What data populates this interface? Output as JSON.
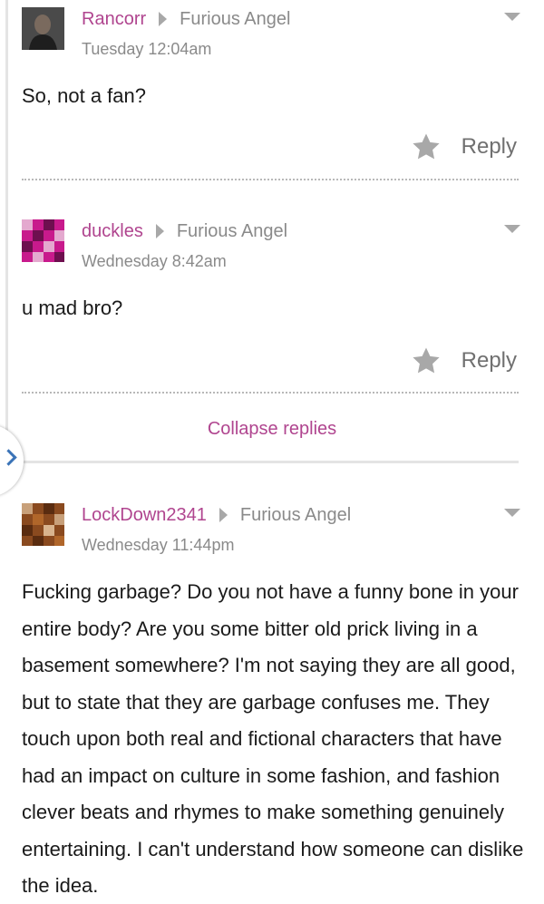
{
  "comments": [
    {
      "author": "Rancorr",
      "reply_to": "Furious Angel",
      "time": "Tuesday 12:04am",
      "body": "So, not a fan?",
      "reply_label": "Reply",
      "avatar_icon": "user-photo-avatar"
    },
    {
      "author": "duckles",
      "reply_to": "Furious Angel",
      "time": "Wednesday 8:42am",
      "body": "u mad bro?",
      "reply_label": "Reply",
      "avatar_icon": "pixel-avatar-magenta"
    },
    {
      "author": "LockDown2341",
      "reply_to": "Furious Angel",
      "time": "Wednesday 11:44pm",
      "body": "Fucking garbage? Do you not have a funny bone in your entire body? Are you some bitter old prick living in a basement somewhere? I'm not saying they are all good, but to state that they are garbage confuses me. They touch upon both real and fictional characters that have had an impact on culture in some fashion, and fashion clever beats and rhymes to make something genuinely entertaining. I can't understand how someone can dislike the idea.",
      "avatar_icon": "pixel-avatar-brown"
    }
  ],
  "collapse_label": "Collapse replies",
  "colors": {
    "author": "#b0458f",
    "meta": "#8a8a8a",
    "accent_blue": "#3a73b7"
  }
}
